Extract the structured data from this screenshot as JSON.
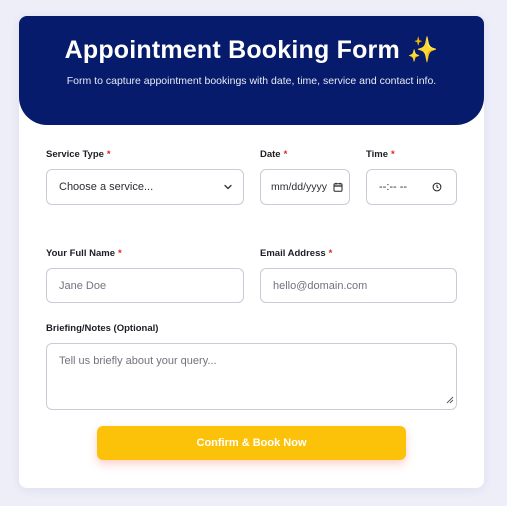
{
  "header": {
    "title": "Appointment Booking Form",
    "title_emoji": "✨",
    "subtitle": "Form to capture appointment bookings with date, time, service and contact info."
  },
  "form": {
    "required_marker": "*",
    "service": {
      "label": "Service Type",
      "selected": "Choose a service..."
    },
    "date": {
      "label": "Date",
      "value": "mm/dd/yyyy"
    },
    "time": {
      "label": "Time",
      "value": "--:-- --"
    },
    "name": {
      "label": "Your Full Name",
      "placeholder": "Jane Doe"
    },
    "email": {
      "label": "Email Address",
      "placeholder": "hello@domain.com"
    },
    "notes": {
      "label": "Briefing/Notes (Optional)",
      "placeholder": "Tell us briefly about your query..."
    },
    "submit_label": "Confirm & Book Now"
  },
  "colors": {
    "header_bg": "#061b6b",
    "accent": "#fcc20a",
    "required": "#e02424"
  }
}
